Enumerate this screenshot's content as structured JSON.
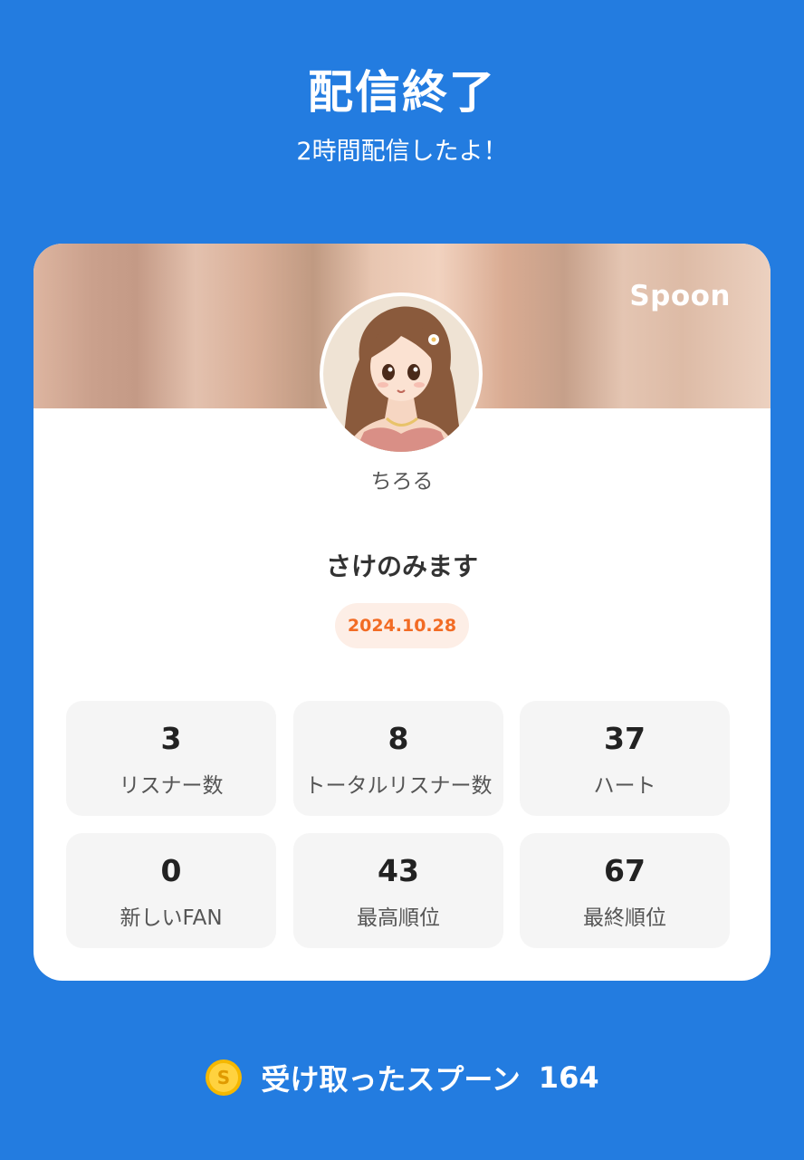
{
  "header": {
    "title": "配信終了",
    "subtitle": "2時間配信したよ！"
  },
  "card": {
    "brand": "Spoon",
    "username": "ちろる",
    "live_title": "さけのみます",
    "date": "2024.10.28",
    "stats": [
      {
        "value": "3",
        "label": "リスナー数"
      },
      {
        "value": "8",
        "label": "トータルリスナー数"
      },
      {
        "value": "37",
        "label": "ハート"
      },
      {
        "value": "0",
        "label": "新しいFAN"
      },
      {
        "value": "43",
        "label": "最高順位"
      },
      {
        "value": "67",
        "label": "最終順位"
      }
    ]
  },
  "footer": {
    "spoon_label": "受け取ったスプーン",
    "spoon_count": "164",
    "coin_icon": "coin-icon"
  },
  "colors": {
    "background": "#237ce0",
    "accent_orange": "#f26b24",
    "badge_bg": "#fdeee6",
    "stat_bg": "#f5f5f5"
  }
}
